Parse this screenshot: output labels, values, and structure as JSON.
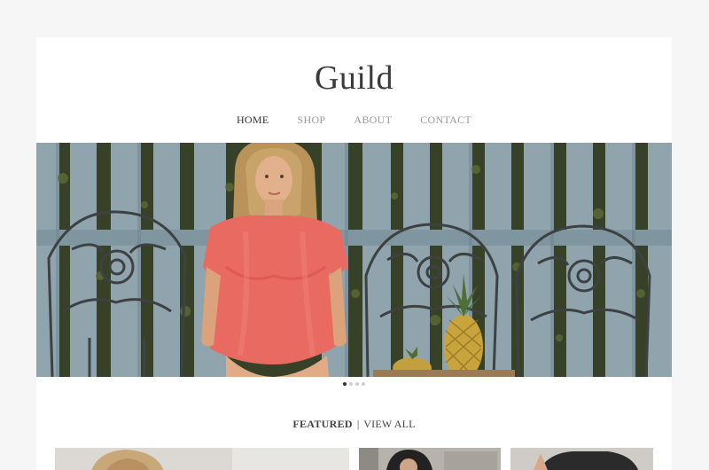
{
  "site": {
    "logo": "Guild"
  },
  "nav": {
    "items": [
      {
        "label": "HOME",
        "active": true
      },
      {
        "label": "SHOP",
        "active": false
      },
      {
        "label": "ABOUT",
        "active": false
      },
      {
        "label": "CONTACT",
        "active": false
      }
    ]
  },
  "hero": {
    "image": "woman-in-coral-dress-sitting-by-fence-with-iron-chairs-and-pineapples",
    "slides": 4,
    "active_slide": 1
  },
  "featured": {
    "title": "FEATURED",
    "separator": "|",
    "link": "VIEW ALL"
  },
  "products": [
    {
      "image": "blonde-woman-portrait"
    },
    {
      "image": "dark-haired-woman-portrait"
    },
    {
      "image": "woman-in-dark-top"
    }
  ],
  "colors": {
    "page_bg": "#f6f6f6",
    "card_bg": "#ffffff",
    "text_dark": "#333333",
    "text_muted": "#9a9a9a",
    "dress": "#e96a60"
  }
}
